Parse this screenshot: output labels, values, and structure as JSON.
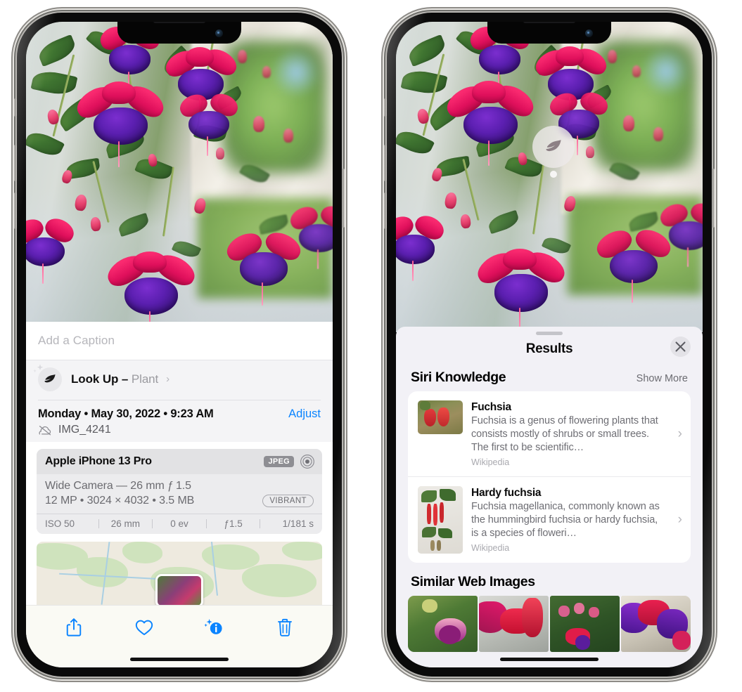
{
  "left_phone": {
    "caption": {
      "placeholder": "Add a Caption",
      "value": ""
    },
    "look_up": {
      "label": "Look Up – ",
      "subject": "Plant",
      "chevron": "›",
      "icon": "leaf-icon"
    },
    "meta": {
      "date_line": "Monday • May 30, 2022 • 9:23 AM",
      "adjust_label": "Adjust",
      "filename": "IMG_4241",
      "cloud_icon": "cloud-slash-icon"
    },
    "device_card": {
      "device_name": "Apple iPhone 13 Pro",
      "format_badge": "JPEG",
      "lens_icon": "aperture-icon",
      "lens_line": "Wide Camera — 26 mm ƒ 1.5",
      "specs_line": "12 MP • 3024 × 4032 • 3.5 MB",
      "style_badge": "VIBRANT",
      "exif": [
        "ISO 50",
        "26 mm",
        "0 ev",
        "ƒ1.5",
        "1/181 s"
      ]
    },
    "toolbar": [
      {
        "name": "share-button",
        "icon": "share-icon"
      },
      {
        "name": "favorite-button",
        "icon": "heart-icon"
      },
      {
        "name": "info-button",
        "icon": "info-sparkle-icon"
      },
      {
        "name": "delete-button",
        "icon": "trash-icon"
      }
    ],
    "map": {
      "pin": "photo-thumbnail-pin"
    }
  },
  "right_phone": {
    "visual_lookup_badge": {
      "icon": "leaf-icon"
    },
    "sheet": {
      "title": "Results",
      "close_label": "✕",
      "sections": [
        {
          "title": "Siri Knowledge",
          "action": "Show More",
          "items": [
            {
              "title": "Fuchsia",
              "description": "Fuchsia is a genus of flowering plants that consists mostly of shrubs or small trees. The first to be scientific…",
              "source": "Wikipedia",
              "chevron": "›"
            },
            {
              "title": "Hardy fuchsia",
              "description": "Fuchsia magellanica, commonly known as the hummingbird fuchsia or hardy fuchsia, is a species of floweri…",
              "source": "Wikipedia",
              "chevron": "›"
            }
          ]
        },
        {
          "title": "Similar Web Images",
          "thumbnails": [
            "fuchsia-pink-white-flower",
            "fuchsia-red-closeup",
            "fuchsia-shrub-buds",
            "fuchsia-purple-red-cluster"
          ]
        }
      ]
    }
  },
  "colors": {
    "accent_blue": "#0a84ff",
    "sheet_bg": "#f2f1f6",
    "card_bg": "#ffffff",
    "secondary_text": "#6e6e74",
    "badge_gray": "#8e8e93"
  }
}
